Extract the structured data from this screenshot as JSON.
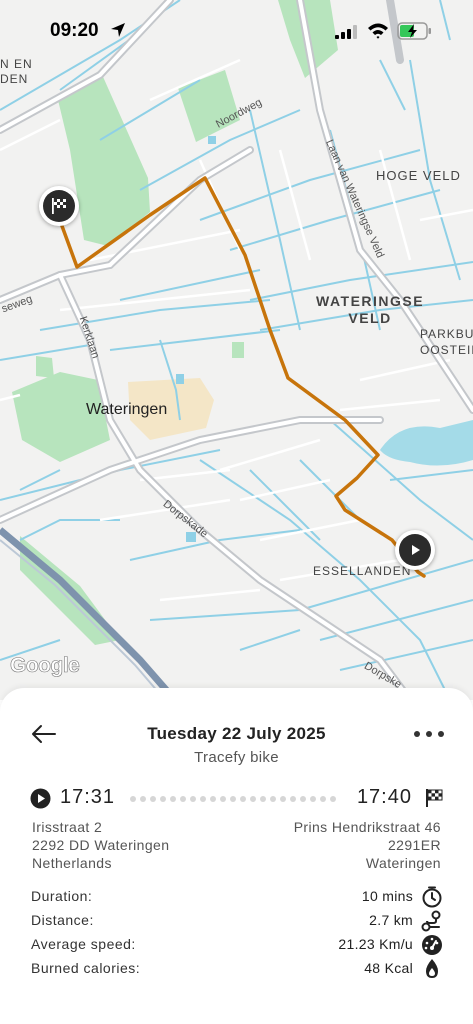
{
  "status_bar": {
    "time": "09:20"
  },
  "map": {
    "labels": {
      "en_den": "N EN\nDEN",
      "noordweg": "Noordweg",
      "laan_van_wateringse_veld": "Laan van Wateringse Veld",
      "hoge_veld": "HOGE VELD",
      "wateringse_veld": "WATERINGSE\nVELD",
      "parkbuurt": "PARKBUU\nOOSTEIN",
      "seweg": "seweg",
      "kerklaan": "Kerklaan",
      "wateringen": "Wateringen",
      "dorpskade": "Dorpskade",
      "essellanden": "ESSELLANDEN",
      "dorpskade_edge": "Dorpske"
    },
    "attribution": "Google",
    "route_color": "#c7740b"
  },
  "trip": {
    "date": "Tuesday 22 July 2025",
    "subtitle": "Tracefy bike",
    "start": {
      "time": "17:31",
      "address_line1": "Irisstraat 2",
      "address_line2": "2292 DD Wateringen",
      "address_line3": "Netherlands"
    },
    "end": {
      "time": "17:40",
      "address_line1": "Prins Hendrikstraat 46",
      "address_line2": "2291ER",
      "address_line3": "Wateringen"
    },
    "stats": [
      {
        "label": "Duration:",
        "value": "10 mins",
        "icon": "timer-icon"
      },
      {
        "label": "Distance:",
        "value": "2.7 km",
        "icon": "route-icon"
      },
      {
        "label": "Average speed:",
        "value": "21.23 Km/u",
        "icon": "speedometer-icon"
      },
      {
        "label": "Burned calories:",
        "value": "48 Kcal",
        "icon": "flame-icon"
      }
    ]
  }
}
